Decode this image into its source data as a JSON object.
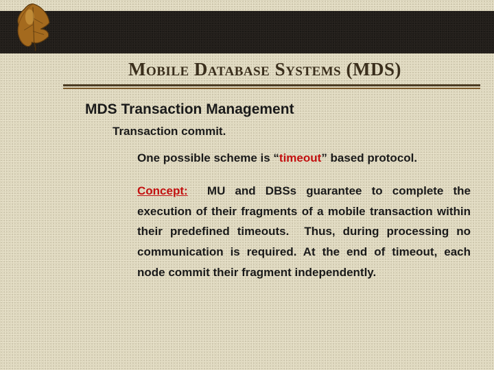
{
  "title": "Mobile Database Systems (MDS)",
  "section": "MDS Transaction Management",
  "subheading": "Transaction commit.",
  "scheme_pre": "One possible scheme is “",
  "scheme_key": "timeout",
  "scheme_post": "” based protocol.",
  "concept_label": "Concept:",
  "concept_body_1": "MU and DBSs guarantee to complete the execution of their fragments of a mobile transaction within their predefined timeouts.",
  "concept_body_2": "Thus, during processing no communication is required.   At the end of timeout, each node commit their fragment independently."
}
